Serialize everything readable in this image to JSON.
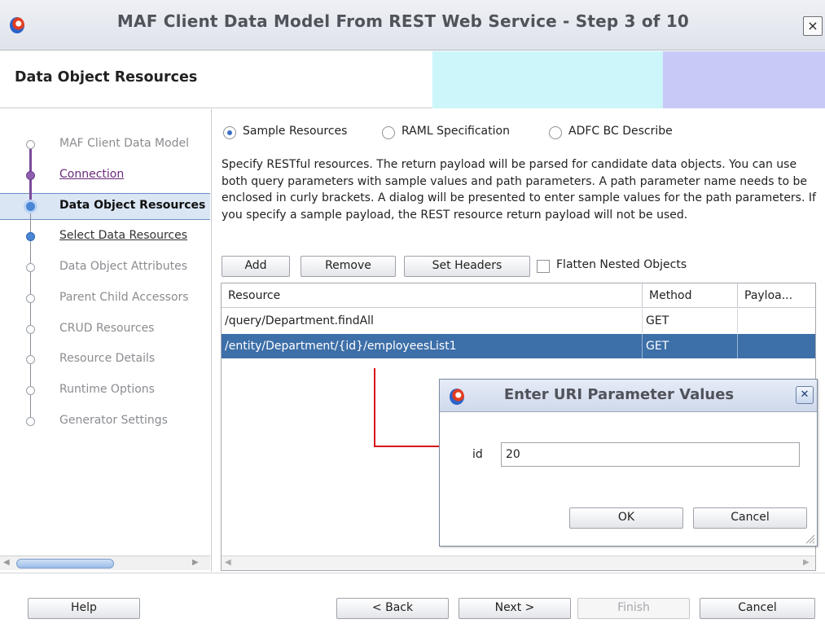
{
  "window": {
    "title": "MAF Client Data Model From REST Web Service - Step 3 of 10",
    "close_glyph": "×"
  },
  "header": {
    "title": "Data Object Resources"
  },
  "nav": {
    "items": [
      {
        "label": "MAF Client Data Model",
        "state": "plain"
      },
      {
        "label": "Connection",
        "state": "visited"
      },
      {
        "label": "Data Object Resources",
        "state": "current"
      },
      {
        "label": "Select Data Resources",
        "state": "next"
      },
      {
        "label": "Data Object Attributes",
        "state": "plain"
      },
      {
        "label": "Parent Child Accessors",
        "state": "plain"
      },
      {
        "label": "CRUD Resources",
        "state": "plain"
      },
      {
        "label": "Resource Details",
        "state": "plain"
      },
      {
        "label": "Runtime Options",
        "state": "plain"
      },
      {
        "label": "Generator Settings",
        "state": "plain"
      }
    ]
  },
  "source": {
    "options": [
      "Sample Resources",
      "RAML Specification",
      "ADFC BC Describe"
    ],
    "selected": "Sample Resources"
  },
  "description": "Specify RESTful resources. The return payload will be parsed for candidate data objects. You can use both query parameters with sample values and path parameters. A path parameter name needs to be enclosed in curly brackets. A dialog will be presented to enter sample values for the path parameters. If you specify a sample payload, the REST resource return payload will not be used.",
  "toolbar": {
    "add_label": "Add",
    "remove_label": "Remove",
    "set_headers_label": "Set Headers",
    "flatten_label": "Flatten Nested Objects",
    "flatten_checked": false
  },
  "table": {
    "columns": [
      "Resource",
      "Method",
      "Payloa..."
    ],
    "rows": [
      {
        "resource": "/query/Department.findAll",
        "method": "GET",
        "payload": ""
      },
      {
        "resource": "/entity/Department/{id}/employeesList1",
        "method": "GET",
        "payload": ""
      }
    ],
    "selected_row": 1
  },
  "dialog": {
    "title": "Enter URI Parameter Values",
    "param_label": "id",
    "param_value": "20",
    "ok_label": "OK",
    "cancel_label": "Cancel"
  },
  "footer": {
    "help_label": "Help",
    "back_label": "< Back",
    "next_label": "Next >",
    "finish_label": "Finish",
    "cancel_label": "Cancel"
  },
  "colors": {
    "accent_cyan": "#ccf6fa",
    "accent_lavender": "#c9c9f7",
    "selection": "#3d6fa8",
    "connector": "#d8121a"
  }
}
